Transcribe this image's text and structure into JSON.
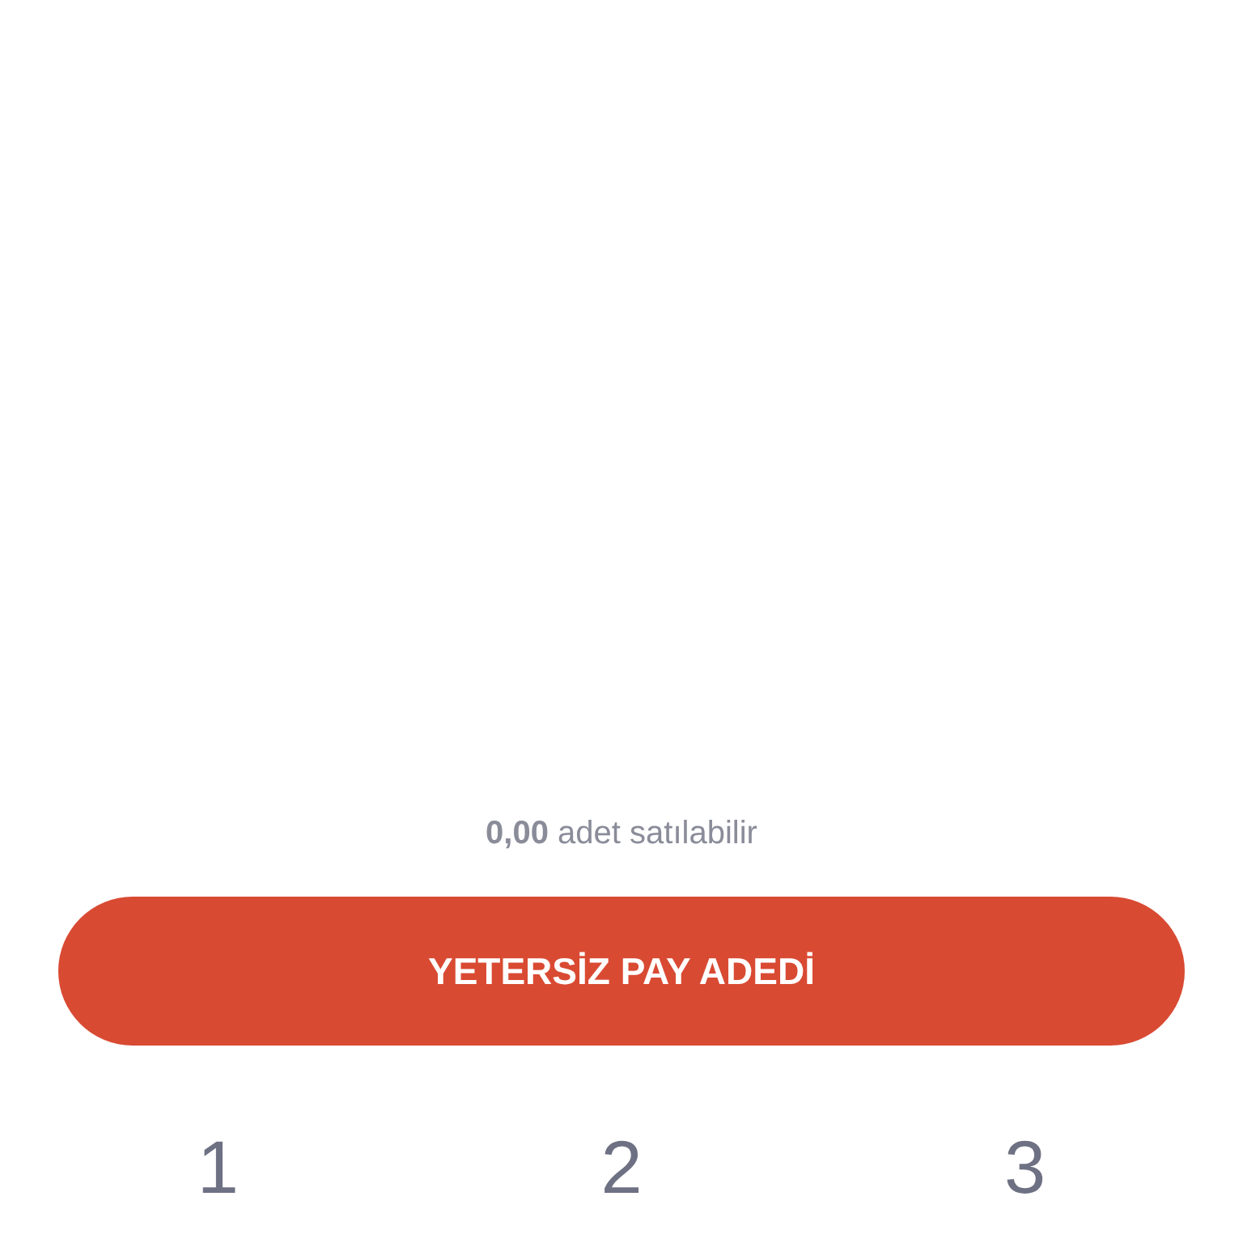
{
  "available_text": "**0,00** adet satılabilir",
  "submit_button": {
    "label": "YETERSİZ PAY ADEDİ"
  },
  "keypad": [
    "1",
    "2",
    "3"
  ]
}
